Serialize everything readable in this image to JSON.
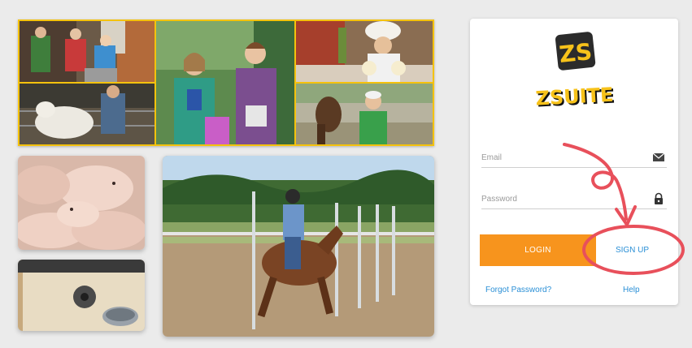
{
  "login": {
    "email_placeholder": "Email",
    "password_placeholder": "Password",
    "login_label": "LOGIN",
    "signup_label": "SIGN UP",
    "forgot_label": "Forgot Password?",
    "help_label": "Help"
  },
  "logo": {
    "monogram": "ZS",
    "wordmark": "ZSUITE"
  },
  "icons": {
    "email": "envelope-icon",
    "password": "lock-icon"
  },
  "colors": {
    "background": "#ebebeb",
    "card": "#ffffff",
    "login_button": "#f7941d",
    "link": "#2a8fd6",
    "annotation": "#e8505b",
    "collage_frame": "#f4c20d"
  }
}
